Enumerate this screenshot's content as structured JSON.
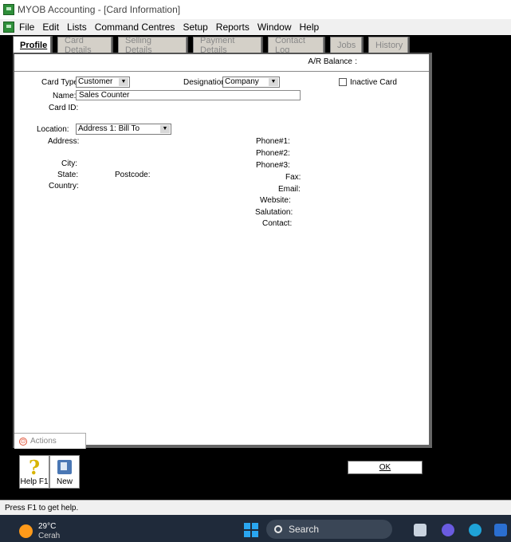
{
  "window": {
    "title": "MYOB Accounting - [Card Information]"
  },
  "menu": [
    "File",
    "Edit",
    "Lists",
    "Command Centres",
    "Setup",
    "Reports",
    "Window",
    "Help"
  ],
  "tabs": [
    {
      "label": "Profile",
      "active": true
    },
    {
      "label": "Card Details",
      "active": false
    },
    {
      "label": "Selling Details",
      "active": false
    },
    {
      "label": "Payment Details",
      "active": false
    },
    {
      "label": "Contact Log",
      "active": false
    },
    {
      "label": "Jobs",
      "active": false
    },
    {
      "label": "History",
      "active": false
    }
  ],
  "ar_balance": {
    "label": "A/R Balance",
    "value": ":"
  },
  "form": {
    "card_type_label": "Card Type:",
    "card_type_value": "Customer",
    "designation_label": "Designation:",
    "designation_value": "Company",
    "inactive_label": "Inactive Card",
    "inactive_checked": false,
    "name_label": "Name:",
    "name_value": "Sales Counter",
    "card_id_label": "Card ID:",
    "location_label": "Location:",
    "location_value": "Address 1:  Bill To",
    "address_label": "Address:",
    "city_label": "City:",
    "state_label": "State:",
    "postcode_label": "Postcode:",
    "country_label": "Country:",
    "phone1_label": "Phone#1:",
    "phone2_label": "Phone#2:",
    "phone3_label": "Phone#3:",
    "fax_label": "Fax:",
    "email_label": "Email:",
    "website_label": "Website:",
    "salutation_label": "Salutation:",
    "contact_label": "Contact:"
  },
  "actions_label": "Actions",
  "toolbar": {
    "help_label": "Help F1",
    "new_label": "New",
    "ok_label": "OK"
  },
  "status": "Press F1 to get help.",
  "taskbar": {
    "temperature": "29°C",
    "condition": "Cerah",
    "search_label": "Search"
  }
}
